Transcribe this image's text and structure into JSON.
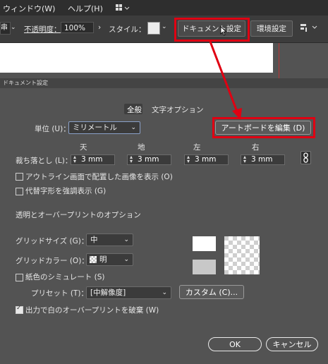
{
  "menubar": {
    "items": [
      "ウィンドウ(W)",
      "ヘルプ(H)"
    ]
  },
  "controlbar": {
    "zoom_value": "串",
    "opacity_label": "不透明度：",
    "opacity_value": "100%",
    "style_label": "スタイル：",
    "document_setup_button": "ドキュメント設定",
    "preferences_button": "環境設定"
  },
  "dialog": {
    "title": "ドキュメント設定",
    "tabs": {
      "general": "全般",
      "text_options": "文字オプション"
    },
    "units_label": "単位 (U)：",
    "units_value": "ミリメートル",
    "edit_artboards_button": "アートボードを編集 (D)",
    "bleed": {
      "label": "裁ち落とし (L)：",
      "columns": [
        "天",
        "地",
        "左",
        "右"
      ],
      "values": [
        "3 mm",
        "3 mm",
        "3 mm",
        "3 mm"
      ]
    },
    "show_placed_images_outline": {
      "label": "アウトライン画面で配置した画像を表示 (O)",
      "checked": false
    },
    "highlight_substituted_glyphs": {
      "label": "代替字形を強調表示 (G)",
      "checked": false
    },
    "transparency_section_title": "透明とオーバープリントのオプション",
    "grid_size_label": "グリッドサイズ (G)：",
    "grid_size_value": "中",
    "grid_color_label": "グリッドカラー (O)：",
    "grid_color_value": "明",
    "simulate_paper_color": {
      "label": "紙色のシミュレート (S)",
      "checked": false
    },
    "preset_label": "プリセット (T)：",
    "preset_value": "[中解像度]",
    "custom_button": "カスタム (C)...",
    "discard_white_overprint": {
      "label": "出力で白のオーバープリントを破棄 (W)",
      "checked": true
    },
    "ok_button": "OK",
    "cancel_button": "キャンセル"
  },
  "colors": {
    "highlight_red": "#e00012",
    "dialog_bg": "#535353"
  }
}
